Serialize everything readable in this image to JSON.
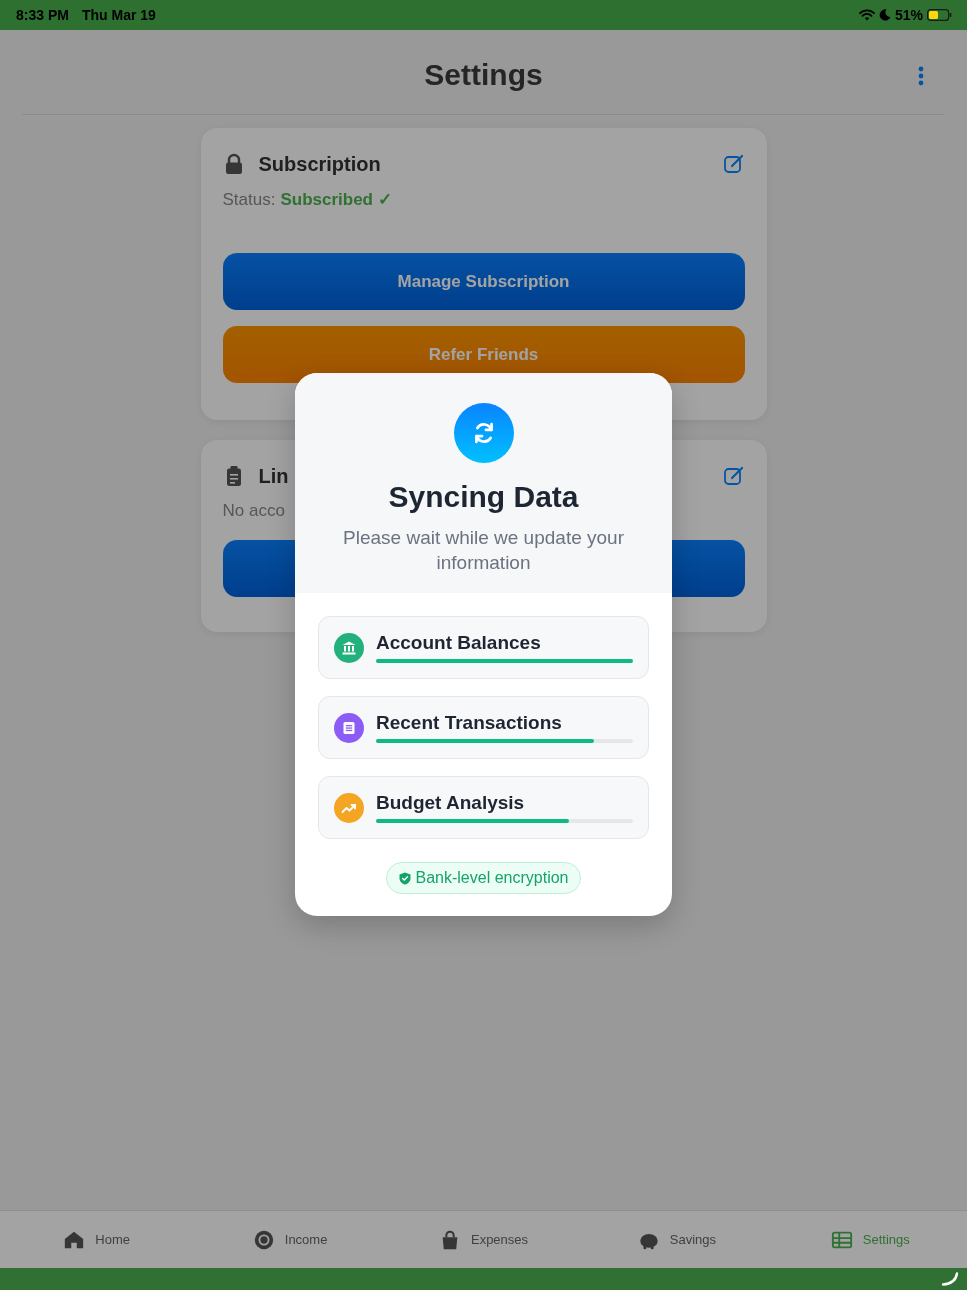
{
  "status_bar": {
    "time": "8:33 PM",
    "date": "Thu Mar 19",
    "battery": "51%"
  },
  "header": {
    "title": "Settings"
  },
  "cards": [
    {
      "kind": "subscription",
      "title": "Subscription",
      "status_label": "Status:",
      "status_value": "Subscribed ✓",
      "buttons": [
        {
          "kind": "primary",
          "label": "Manage Subscription"
        },
        {
          "kind": "warning",
          "label": "Refer Friends"
        }
      ]
    },
    {
      "kind": "accounts",
      "title": "Lin",
      "note": "No acco",
      "buttons": [
        {
          "kind": "primary"
        }
      ]
    }
  ],
  "tab_bar": {
    "tabs": [
      {
        "label": "Home",
        "selected": false
      },
      {
        "label": "Income",
        "selected": false
      },
      {
        "label": "Expenses",
        "selected": false
      },
      {
        "label": "Savings",
        "selected": false
      },
      {
        "label": "Settings",
        "selected": true
      }
    ]
  },
  "modal": {
    "title": "Syncing Data",
    "message": "Please wait while we update your information",
    "items": [
      {
        "label": "Account Balances",
        "color": "#22b07d",
        "level": 1
      },
      {
        "label": "Recent Transactions",
        "color": "#8b5cf6",
        "level": 0.85
      },
      {
        "label": "Budget Analysis",
        "color": "#f5a524",
        "level": 0.75
      }
    ],
    "badge": "Bank-level encryption"
  }
}
